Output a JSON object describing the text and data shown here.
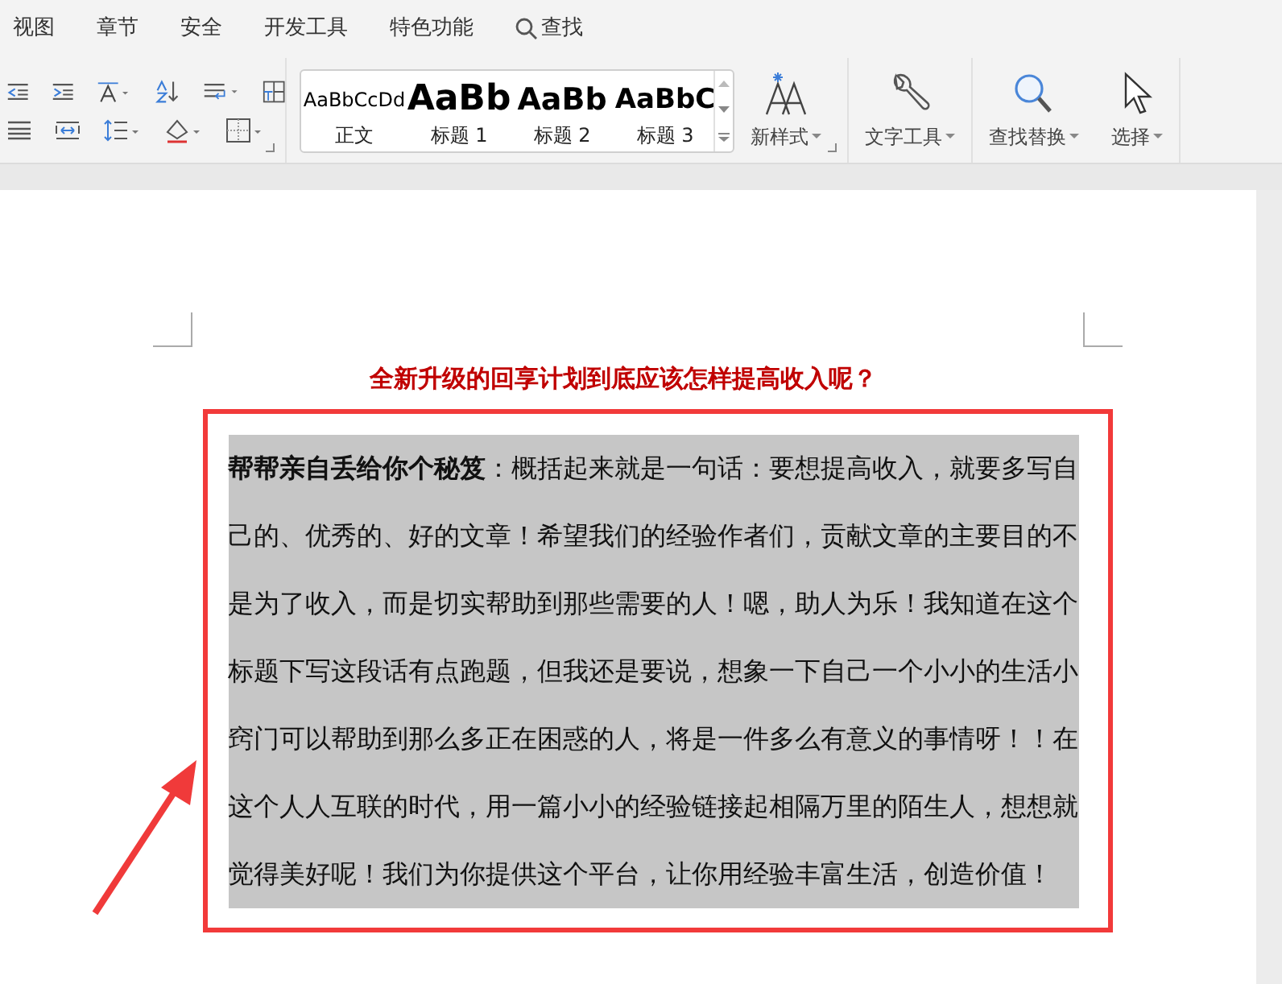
{
  "menu_tabs": [
    {
      "label": "视图",
      "kind": "tab"
    },
    {
      "label": "章节",
      "kind": "tab"
    },
    {
      "label": "安全",
      "kind": "tab"
    },
    {
      "label": "开发工具",
      "kind": "tab"
    },
    {
      "label": "特色功能",
      "kind": "tab"
    },
    {
      "label": "查找",
      "kind": "search"
    }
  ],
  "style_gallery": [
    {
      "preview": "AaBbCcDd",
      "label": "正文",
      "kind": "body"
    },
    {
      "preview": "AaBb",
      "label": "标题 1",
      "kind": "h1"
    },
    {
      "preview": "AaBb",
      "label": "标题 2",
      "kind": "h2"
    },
    {
      "preview": "AaBbC",
      "label": "标题 3",
      "kind": "h3"
    }
  ],
  "ribbon_buttons": [
    {
      "label": "新样式",
      "kind": "new-style"
    },
    {
      "label": "文字工具",
      "kind": "text-tools"
    },
    {
      "label": "查找替换",
      "kind": "find-replace"
    },
    {
      "label": "选择",
      "kind": "select"
    }
  ],
  "document": {
    "title": "全新升级的回享计划到底应该怎样提高收入呢？",
    "paragraph": "**帮帮亲自丢给你个秘笈**：概括起来就是一句话：要想提高收入，就要多写自己的、优秀的、好的文章！希望我们的经验作者们，贡献文章的主要目的不是为了收入，而是切实帮助到那些需要的人！嗯，助人为乐！我知道在这个标题下写这段话有点跑题，但我还是要说，想象一下自己一个小小的生活小窍门可以帮助到那么多正在困惑的人，将是一件多么有意义的事情呀！！在这个人人互联的时代，用一篇小小的经验链接起相隔万里的陌生人，想想就觉得美好呢！我们为你提供这个平台，让你用经验丰富生活，创造价值！",
    "selected": true
  }
}
